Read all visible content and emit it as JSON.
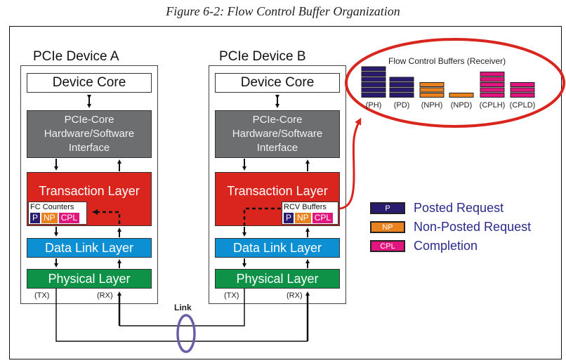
{
  "caption": "Figure 6-2: Flow Control Buffer Organization",
  "devices": [
    {
      "title": "PCIe Device A",
      "device_core": "Device Core",
      "interface_lines": [
        "PCIe-Core",
        "Hardware/Software",
        "Interface"
      ],
      "transaction_layer": "Transaction Layer",
      "buffer_box_label": "FC Counters",
      "data_link_layer": "Data Link Layer",
      "physical_layer": "Physical Layer",
      "tx": "(TX)",
      "rx": "(RX)"
    },
    {
      "title": "PCIe Device B",
      "device_core": "Device Core",
      "interface_lines": [
        "PCIe-Core",
        "Hardware/Software",
        "Interface"
      ],
      "transaction_layer": "Transaction Layer",
      "buffer_box_label": "RCV Buffers",
      "data_link_layer": "Data Link Layer",
      "physical_layer": "Physical Layer",
      "tx": "(TX)",
      "rx": "(RX)"
    }
  ],
  "chips": {
    "p": "P",
    "np": "NP",
    "cpl": "CPL"
  },
  "link_label": "Link",
  "flow_control_buffers": {
    "title": "Flow Control Buffers (Receiver)",
    "buffers": [
      {
        "label": "(PH)",
        "type": "p",
        "slots": 6
      },
      {
        "label": "(PD)",
        "type": "p",
        "slots": 4
      },
      {
        "label": "(NPH)",
        "type": "np",
        "slots": 3
      },
      {
        "label": "(NPD)",
        "type": "np",
        "slots": 1
      },
      {
        "label": "(CPLH)",
        "type": "cpl",
        "slots": 5
      },
      {
        "label": "(CPLD)",
        "type": "cpl",
        "slots": 3
      }
    ]
  },
  "legend": [
    {
      "chip": "P",
      "text": "Posted Request",
      "type": "p"
    },
    {
      "chip": "NP",
      "text": "Non-Posted Request",
      "type": "np"
    },
    {
      "chip": "CPL",
      "text": "Completion",
      "type": "cpl"
    }
  ],
  "colors": {
    "posted": "#2a1b6e",
    "non_posted": "#e8821e",
    "completion": "#e0157e",
    "transaction_layer": "#d9251d",
    "data_link_layer": "#0d8fd3",
    "physical_layer": "#0d9247",
    "interface": "#6d6e70",
    "link_ellipse": "#6b5ea8",
    "highlight": "#d9251d"
  }
}
